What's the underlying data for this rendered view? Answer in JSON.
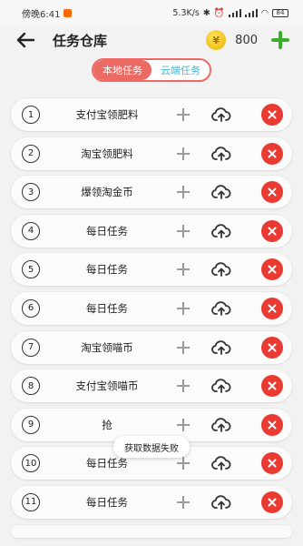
{
  "status_bar": {
    "time": "傍晚6:41",
    "net_speed": "5.3K/s",
    "battery": "84"
  },
  "header": {
    "title": "任务仓库",
    "coin_count": "800"
  },
  "tabs": [
    {
      "label": "本地任务",
      "active": true
    },
    {
      "label": "云端任务",
      "active": false
    }
  ],
  "tasks": [
    {
      "num": "1",
      "name": "支付宝领肥料"
    },
    {
      "num": "2",
      "name": "淘宝领肥料"
    },
    {
      "num": "3",
      "name": "爆领淘金币"
    },
    {
      "num": "4",
      "name": "每日任务"
    },
    {
      "num": "5",
      "name": "每日任务"
    },
    {
      "num": "6",
      "name": "每日任务"
    },
    {
      "num": "7",
      "name": "淘宝领喵币"
    },
    {
      "num": "8",
      "name": "支付宝领喵币"
    },
    {
      "num": "9",
      "name": "抢"
    },
    {
      "num": "10",
      "name": "每日任务"
    },
    {
      "num": "11",
      "name": "每日任务"
    }
  ],
  "toast": "获取数据失败",
  "colors": {
    "accent_red": "#ea3b33",
    "tab_active": "#ec6a64",
    "tab_inactive_text": "#4bb3d4",
    "plus_green": "#3aad2b"
  }
}
